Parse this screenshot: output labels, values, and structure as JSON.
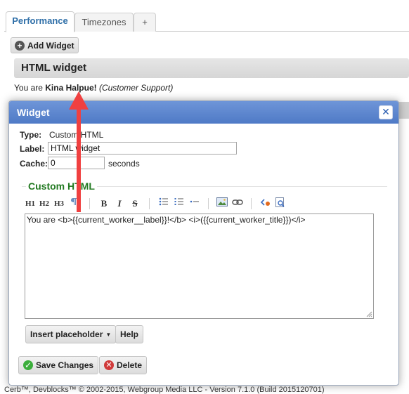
{
  "tabs": [
    {
      "label": "Performance",
      "active": true
    },
    {
      "label": "Timezones",
      "active": false
    },
    {
      "label": "+",
      "active": false
    }
  ],
  "add_widget": {
    "label": "Add Widget",
    "icon": "plus-circle-icon"
  },
  "widget_bar": {
    "title": "HTML widget"
  },
  "greeting": {
    "prefix": "You are ",
    "name": "Kina Halpue!",
    "role": "(Customer Support)"
  },
  "dialog": {
    "title": "Widget",
    "close_icon": "close-icon",
    "type_label": "Type:",
    "type_value": "Custom HTML",
    "label_label": "Label:",
    "label_value": "HTML widget",
    "cache_label": "Cache:",
    "cache_value": "0",
    "cache_unit": "seconds",
    "section_title": "Custom HTML",
    "toolbar": {
      "h1": "H1",
      "h2": "H2",
      "h3": "H3",
      "bold": "B",
      "italic": "I",
      "strike": "S"
    },
    "editor_text": "You are <b>{{current_worker__label}}!</b> <i>({{current_worker_title}})</i>",
    "insert_placeholder": "Insert placeholder",
    "help": "Help",
    "save": "Save Changes",
    "delete": "Delete"
  },
  "footer": {
    "text": "Cerb™, Devblocks™ © 2002-2015, Webgroup Media LLC - Version 7.1.0 (Build 2015120701)"
  },
  "colors": {
    "titlebar": "#5b86cf",
    "section_title": "#237a22",
    "tab_active_text": "#2f6fa8",
    "annotation_arrow": "#f04040",
    "save_icon": "#3bae3b",
    "delete_icon": "#d03a3a"
  }
}
